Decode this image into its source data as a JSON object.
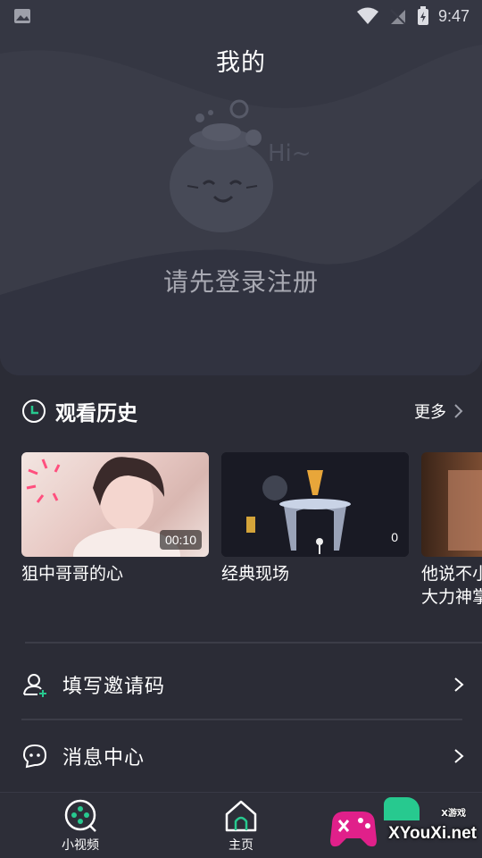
{
  "status_bar": {
    "time": "9:47",
    "icons": [
      "image-icon",
      "wifi-icon",
      "no-signal-icon",
      "battery-charging-icon"
    ]
  },
  "profile": {
    "title": "我的",
    "mascot_greeting": "Hi~",
    "login_prompt": "请先登录注册"
  },
  "history": {
    "title": "观看历史",
    "more_label": "更多",
    "items": [
      {
        "title": "狙中哥哥的心",
        "badge": "00:10"
      },
      {
        "title": "经典现场",
        "badge": "0"
      },
      {
        "title": "他说不小\n大力神掌",
        "badge": ""
      }
    ]
  },
  "menu": {
    "invite_label": "填写邀请码",
    "messages_label": "消息中心"
  },
  "bottom_nav": {
    "items": [
      {
        "label": "小视频",
        "icon": "gamepad-icon"
      },
      {
        "label": "主页",
        "icon": "home-icon"
      }
    ]
  },
  "watermark": {
    "text": "XYouXi.net",
    "small": "X游戏"
  },
  "colors": {
    "background": "#2b2c36",
    "card": "#3a3c48",
    "accent": "#27c98f",
    "muted_text": "#a8a9b2"
  }
}
